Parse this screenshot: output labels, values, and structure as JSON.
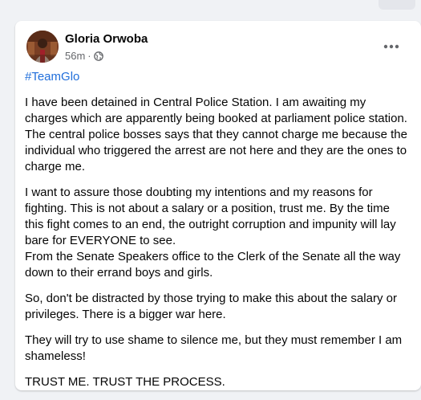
{
  "post": {
    "author": "Gloria Orwoba",
    "time": "56m",
    "separator": "·",
    "privacy_icon": "globe-icon",
    "more_icon": "more-options-icon",
    "hashtag": "#TeamGlo",
    "paragraphs": [
      "I have been detained in Central Police Station. I am awaiting my charges which are apparently being booked at parliament police station. The central police bosses says that they cannot charge me because the individual who triggered the arrest are not here and they are the ones to charge me.",
      "I want to assure those doubting my intentions and my reasons for fighting. This is not about a salary or a position, trust me. By the time this fight comes to an end, the outright corruption and impunity will lay bare for EVERYONE to see.\nFrom the Senate Speakers office to the Clerk of the Senate all the way down to their errand boys and girls.",
      "So, don't be distracted by those trying to make this about the salary or privileges. There is a bigger war here.",
      "They will try to use shame to silence me, but they must remember I am shameless!",
      "TRUST ME. TRUST THE PROCESS."
    ]
  },
  "colors": {
    "hashtag": "#216fdb",
    "text": "#050505",
    "meta": "#65676b",
    "background": "#f0f2f5"
  }
}
